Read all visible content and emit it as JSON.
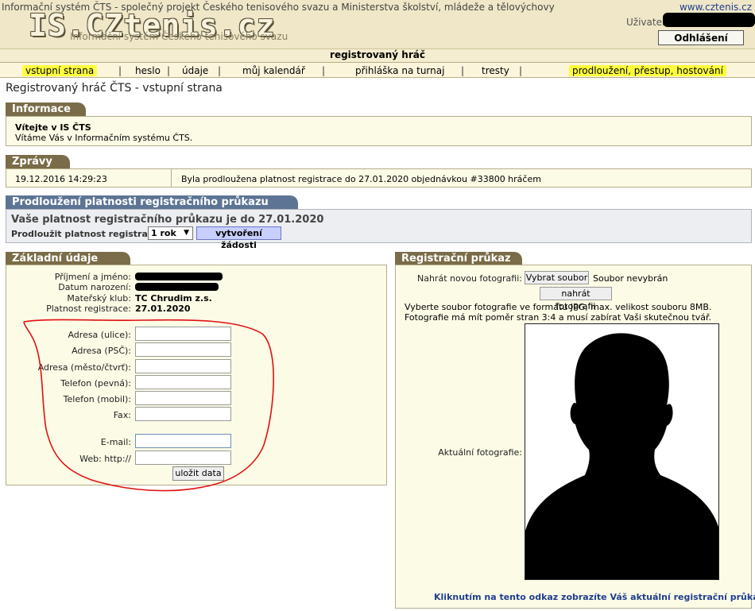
{
  "header": {
    "top_line": "Informační systém ČTS - společný projekt Českého tenisového svazu a Ministerstva školství, mládeže a tělovýchovy",
    "top_link": "www.cztenis.cz",
    "logo": "IS.CZtenis.cz",
    "logo_sub": "Informační systém Českého tenisového svazu",
    "user_label": "Uživatel:",
    "logout": "Odhlášení"
  },
  "role": "registrovaný hráč",
  "nav": {
    "items": [
      {
        "label": "vstupní strana"
      },
      {
        "label": "heslo"
      },
      {
        "label": "údaje"
      },
      {
        "label": "můj kalendář"
      },
      {
        "label": "přihláška na turnaj"
      },
      {
        "label": "tresty"
      },
      {
        "label": "prodloužení, přestup, hostování"
      }
    ]
  },
  "page_title": "Registrovaný hráč ČTS - vstupní strana",
  "info": {
    "tab": "Informace",
    "title": "Vítejte v IS ČTS",
    "text": "Vítáme Vás v Informačním systému ČTS."
  },
  "messages": {
    "tab": "Zprávy",
    "rows": [
      {
        "date": "19.12.2016 14:29:23",
        "text": "Byla prodloužena platnost registrace do 27.01.2020 objednávkou #33800 hráčem"
      }
    ]
  },
  "extension": {
    "tab": "Prodloužení platnosti registračního průkazu",
    "heading": "Vaše platnost registračního průkazu je do 27.01.2020",
    "label": "Prodloužit platnost registrace o",
    "select_value": "1 rok",
    "button": "vytvoření žádosti"
  },
  "basic": {
    "tab": "Základní údaje",
    "name_label": "Příjmení a jméno:",
    "birth_label": "Datum narození:",
    "club_label": "Mateřský klub:",
    "club_value": "TC Chrudim z.s.",
    "valid_label": "Platnost registrace:",
    "valid_value": "27.01.2020",
    "fields": {
      "street": "Adresa (ulice):",
      "zip": "Adresa (PSČ):",
      "city": "Adresa (město/čtvrť):",
      "phone": "Telefon (pevná):",
      "mobile": "Telefon (mobil):",
      "fax": "Fax:",
      "email": "E-mail:",
      "web": "Web: http://"
    },
    "save": "uložit data"
  },
  "card": {
    "tab": "Registrační průkaz",
    "upload_label": "Nahrát novou fotografii:",
    "choose_button": "Vybrat soubor",
    "no_file": "Soubor nevybrán",
    "upload_button": "nahrát fotografii",
    "hint": "Vyberte soubor fotografie ve formátu JPG, max. velikost souboru 8MB. Fotografie má mít poměr stran 3:4 a musí zabírat Vaši skutečnou tvář.",
    "current_label": "Aktuální fotografie:",
    "link": "Kliknutím na tento odkaz zobrazíte Váš aktuální registrační průkaz"
  },
  "colors": {
    "tab_brown": "#7a6c48",
    "tab_blue": "#5d7494",
    "highlight": "#ffff3d",
    "annotation_red": "#e01010",
    "link_blue": "#1f3e8f"
  }
}
